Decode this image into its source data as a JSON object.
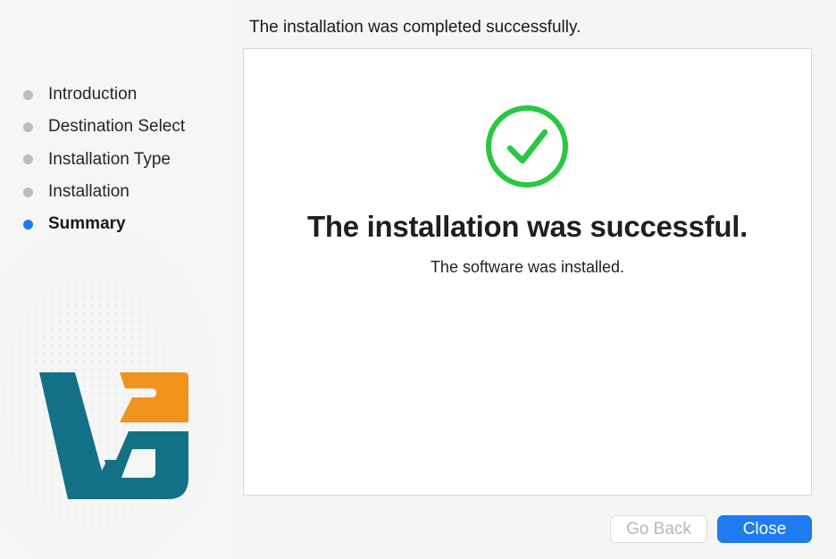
{
  "header": {
    "message": "The installation was completed successfully."
  },
  "sidebar": {
    "steps": [
      {
        "label": "Introduction",
        "state": "done"
      },
      {
        "label": "Destination Select",
        "state": "done"
      },
      {
        "label": "Installation Type",
        "state": "done"
      },
      {
        "label": "Installation",
        "state": "done"
      },
      {
        "label": "Summary",
        "state": "current"
      }
    ],
    "logo_icon": "app-logo-icon"
  },
  "main": {
    "status_icon": "success-checkmark-icon",
    "title": "The installation was successful.",
    "subtitle": "The software was installed."
  },
  "buttons": {
    "go_back": "Go Back",
    "close": "Close"
  },
  "colors": {
    "accent": "#1f7bf2",
    "success": "#28c840",
    "logo_teal": "#137187",
    "logo_orange": "#f0931d",
    "inactive_bullet": "#bdbdbd"
  }
}
